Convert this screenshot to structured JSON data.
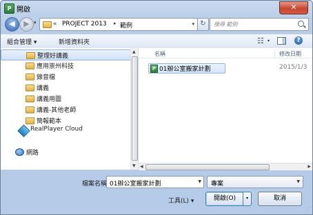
{
  "window": {
    "title": "開啟",
    "app_icon_letter": "P",
    "close_glyph": "✕"
  },
  "nav": {
    "back_glyph": "◀",
    "forward_glyph": "▶",
    "history_dropdown": "▾",
    "address": {
      "chevron": "«",
      "segments": [
        "PROJECT 2013",
        "範例"
      ],
      "separator": "▸",
      "dropdown": "▾"
    },
    "refresh_glyph": "↻",
    "search_placeholder": "搜尋 範例"
  },
  "toolbar": {
    "organize_label": "組合管理 ▾",
    "new_folder_label": "新增資料夾",
    "view_glyph": "☷",
    "view_dropdown": "▾",
    "help_glyph": "?"
  },
  "sidebar": {
    "folders": [
      "整理好講義",
      "應用崇州科技",
      "錄音檔",
      "講義",
      "講義用圖",
      "講義-其他老師",
      "簡報範本"
    ],
    "cloud_label": "RealPlayer Cloud",
    "network_label": "網路"
  },
  "file_list": {
    "columns": {
      "name": "名稱",
      "date": "修改日期"
    },
    "files": [
      {
        "name": "01辦公室搬家計劃",
        "date": "2015/1/3",
        "icon": "project-file-icon"
      }
    ]
  },
  "footer": {
    "filename_label": "檔案名稱(N):",
    "filename_value": "01辦公室搬家計劃",
    "filetype_value": "專案",
    "tools_label": "工具(L) ▾",
    "open_label": "開啟(O)",
    "open_split_glyph": "▾",
    "cancel_label": "取消"
  },
  "colors": {
    "accent": "#3c7fb1",
    "chrome": "#bcd0ea",
    "close": "#c7452f"
  }
}
